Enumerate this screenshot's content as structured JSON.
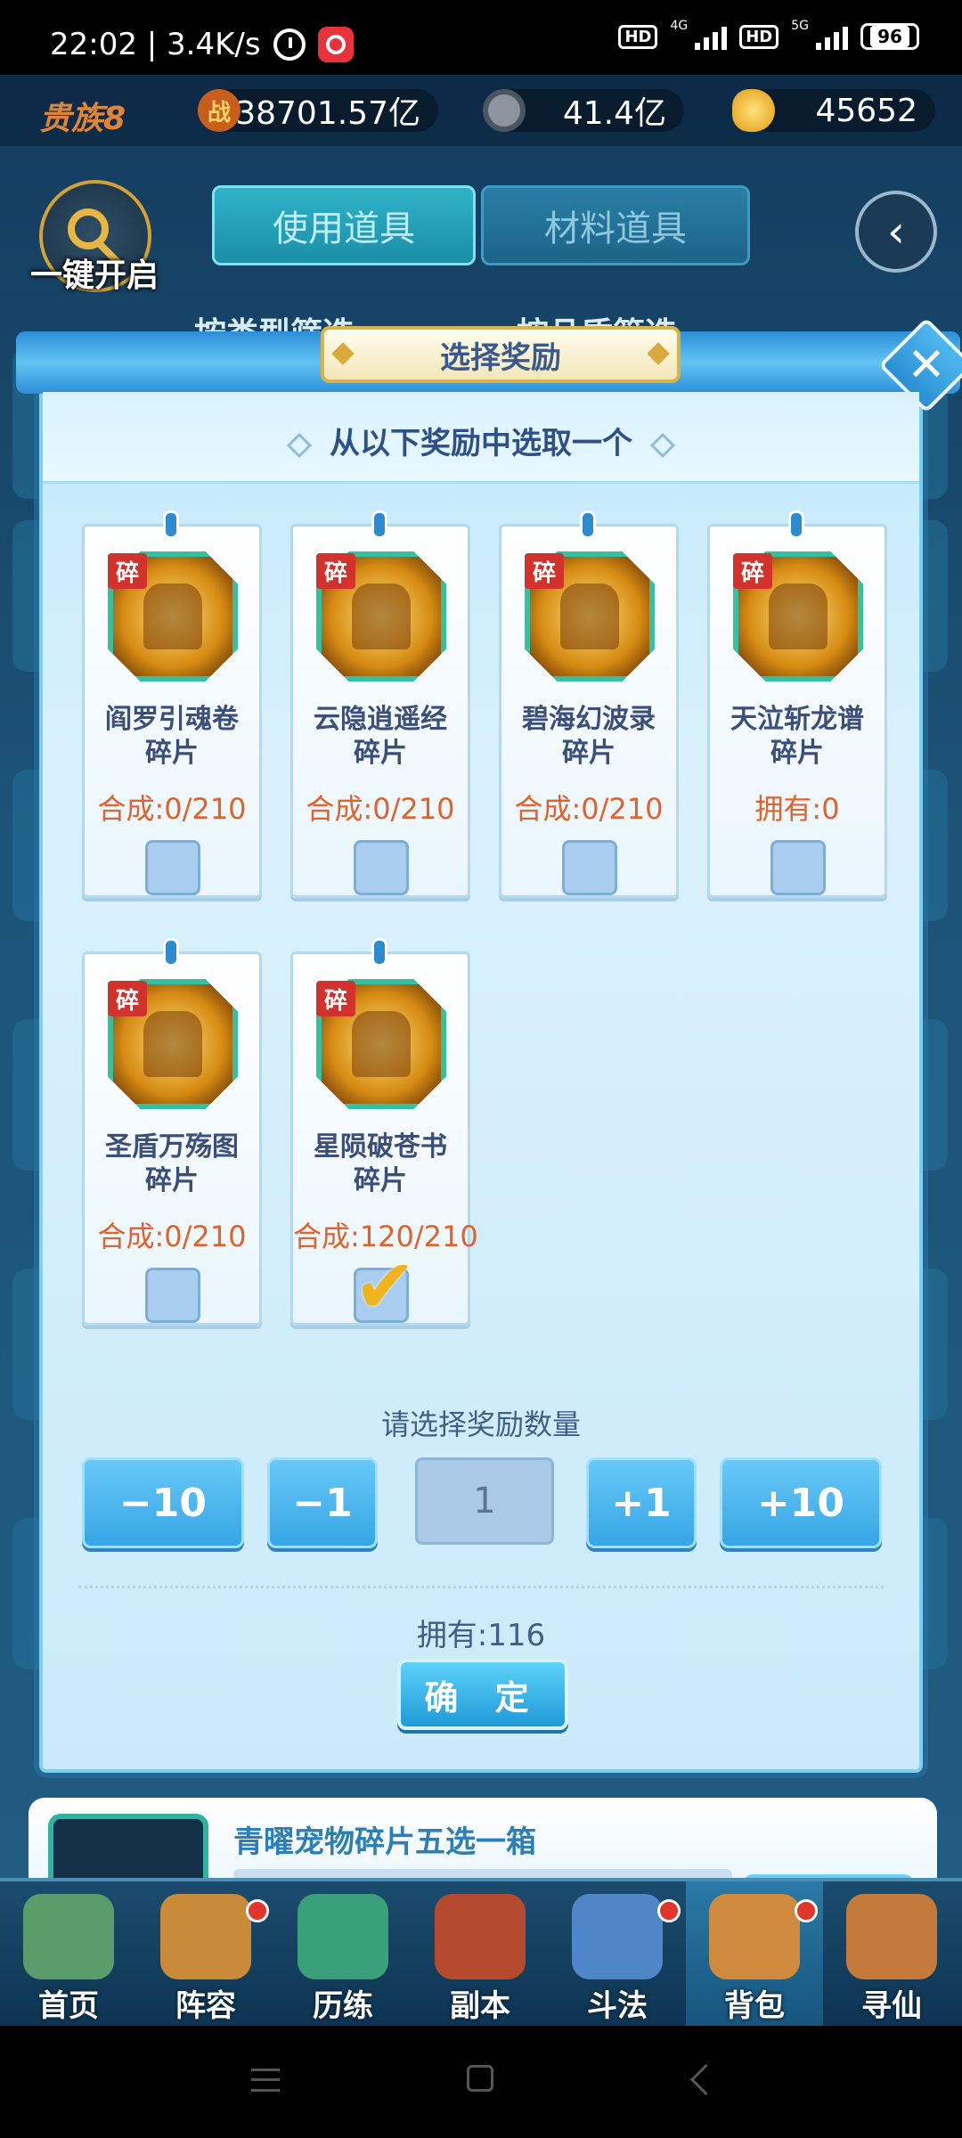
{
  "status_bar": {
    "time_speed": "22:02 | 3.4K/s",
    "hd1": "HD",
    "net1": "4G",
    "hd2": "HD",
    "net2": "5G",
    "battery": "96"
  },
  "resources": {
    "noble": "贵族8",
    "power_icon": "战",
    "power": "38701.57亿",
    "coins": "41.4亿",
    "ingots": "45652"
  },
  "header": {
    "one_key_open": "一键开启",
    "tabs": [
      "使用道具",
      "材料道具"
    ],
    "filters": [
      "按类型筛选",
      "按品质筛选"
    ]
  },
  "modal": {
    "title": "选择奖励",
    "subtitle": "从以下奖励中选取一个",
    "cards": [
      {
        "badge": "碎",
        "name_line1": "阎罗引魂卷",
        "name_line2": "碎片",
        "stat": "合成:0/210",
        "selected": false
      },
      {
        "badge": "碎",
        "name_line1": "云隐逍遥经",
        "name_line2": "碎片",
        "stat": "合成:0/210",
        "selected": false
      },
      {
        "badge": "碎",
        "name_line1": "碧海幻波录",
        "name_line2": "碎片",
        "stat": "合成:0/210",
        "selected": false
      },
      {
        "badge": "碎",
        "name_line1": "天泣斩龙谱",
        "name_line2": "碎片",
        "stat": "拥有:0",
        "selected": false
      },
      {
        "badge": "碎",
        "name_line1": "圣盾万殇图",
        "name_line2": "碎片",
        "stat": "合成:0/210",
        "selected": false
      },
      {
        "badge": "碎",
        "name_line1": "星陨破苍书",
        "name_line2": "碎片",
        "stat": "合成:120/210",
        "selected": true
      }
    ],
    "quantity_label": "请选择奖励数量",
    "buttons": {
      "minus10": "−10",
      "minus1": "−1",
      "plus1": "+1",
      "plus10": "+10"
    },
    "quantity_value": "1",
    "owned": "拥有:116",
    "confirm": "确 定",
    "check_glyph": "✔"
  },
  "peek_item": {
    "title": "青曜宠物碎片五选一箱"
  },
  "bottom_nav": [
    {
      "label": "首页",
      "dot": false,
      "color": "#5a9c6a"
    },
    {
      "label": "阵容",
      "dot": true,
      "color": "#c98b3a"
    },
    {
      "label": "历练",
      "dot": false,
      "color": "#3aa07a"
    },
    {
      "label": "副本",
      "dot": false,
      "color": "#b54a2e"
    },
    {
      "label": "斗法",
      "dot": true,
      "color": "#4f86c8"
    },
    {
      "label": "背包",
      "dot": true,
      "color": "#cf8a3e"
    },
    {
      "label": "寻仙",
      "dot": false,
      "color": "#c47a3a"
    }
  ]
}
